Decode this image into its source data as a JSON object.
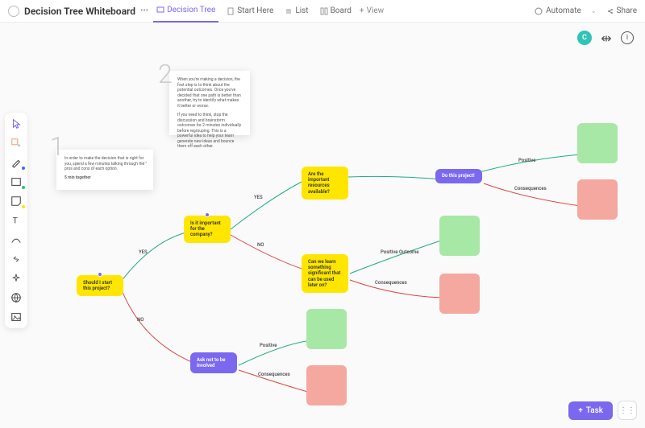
{
  "header": {
    "title": "Decision Tree Whiteboard",
    "tabs": [
      {
        "label": "Decision Tree",
        "active": true
      },
      {
        "label": "Start Here"
      },
      {
        "label": "List"
      },
      {
        "label": "Board"
      }
    ],
    "view_button": "View",
    "automate": "Automate",
    "share": "Share"
  },
  "user": {
    "avatar_initial": "C"
  },
  "notes": {
    "n1": {
      "number": "1",
      "body": "In order to make the decision that is right for you, spend a few minutes talking through the pros and cons of each option.",
      "footer": "5 min together"
    },
    "n2": {
      "number": "2",
      "body1": "When you're making a decision, the first step is to think about the potential outcomes. Once you've decided that one path is better than another, try to identify what makes it better or worse.",
      "body2": "If you need to think, stop the discussion and brainstorm outcomes for 2 minutes individually before regrouping. This is a powerful idea to help your team generate new ideas and bounce them off each other."
    }
  },
  "cards": {
    "start": "Should I start this project?",
    "important_company": "Is it important for the company?",
    "res_avail": "Are the important resources available?",
    "do_project": "Do this project!",
    "learn": "Can we learn something significant that can be used later on?",
    "ask_not": "Ask not to be involved"
  },
  "labels": {
    "yes": "YES",
    "no": "NO",
    "positive": "Positive",
    "positive_outcome": "Positive Outcome",
    "consequences": "Consequences"
  },
  "task_button": "Task"
}
